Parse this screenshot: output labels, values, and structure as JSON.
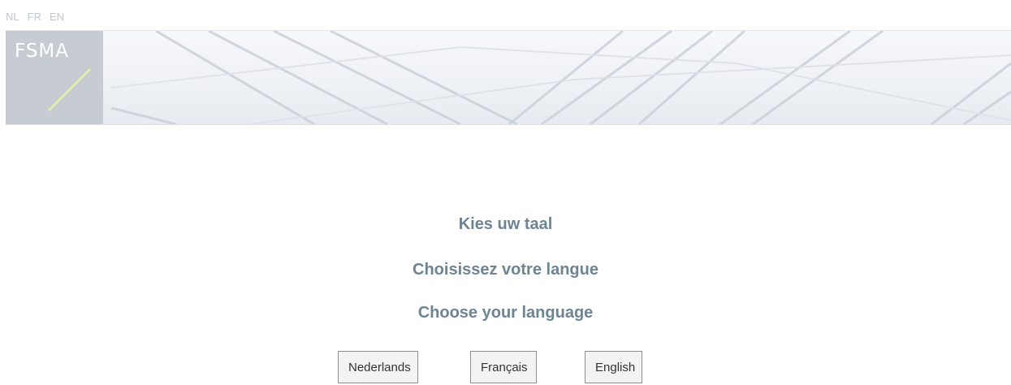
{
  "top_nav": {
    "languages": [
      "NL",
      "FR",
      "EN"
    ]
  },
  "logo": {
    "text": "FSMA"
  },
  "headings": {
    "nl": "Kies uw taal",
    "fr": "Choisissez votre langue",
    "en": "Choose your language"
  },
  "buttons": {
    "nl": "Nederlands",
    "fr": "Français",
    "en": "English"
  },
  "colors": {
    "heading": "#6d8593",
    "nav_link": "#c2c6cb",
    "logo_box": "#c7ccd3",
    "logo_slash": "#e5ecb0"
  }
}
